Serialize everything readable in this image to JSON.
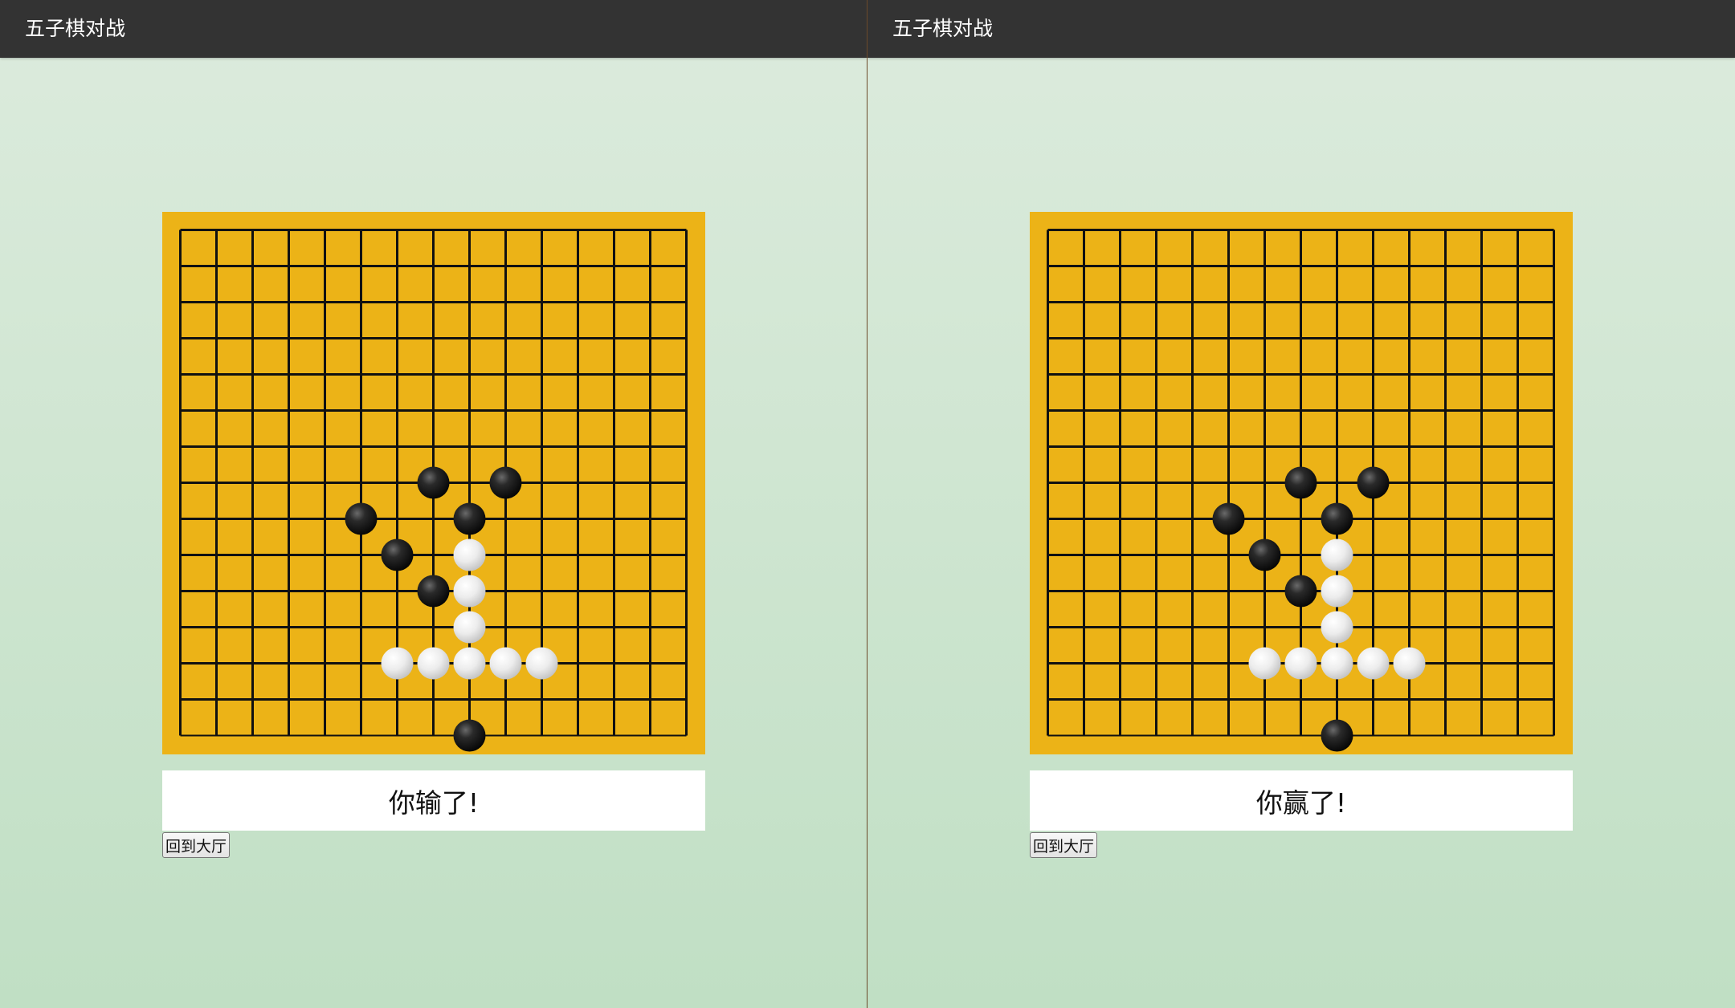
{
  "panes": [
    {
      "nav_title": "五子棋对战",
      "result_text": "你输了!",
      "back_button_label": "回到大厅"
    },
    {
      "nav_title": "五子棋对战",
      "result_text": "你赢了!",
      "back_button_label": "回到大厅"
    }
  ],
  "board": {
    "size": 15,
    "colors": {
      "board": "#ecb317",
      "line": "#111111",
      "black_stone": "#1a1a1a",
      "white_stone": "#e8e8e8"
    },
    "stones": [
      {
        "col": 7,
        "row": 7,
        "color": "black"
      },
      {
        "col": 9,
        "row": 7,
        "color": "black"
      },
      {
        "col": 5,
        "row": 8,
        "color": "black"
      },
      {
        "col": 8,
        "row": 8,
        "color": "black"
      },
      {
        "col": 6,
        "row": 9,
        "color": "black"
      },
      {
        "col": 7,
        "row": 10,
        "color": "black"
      },
      {
        "col": 8,
        "row": 14,
        "color": "black"
      },
      {
        "col": 8,
        "row": 9,
        "color": "white"
      },
      {
        "col": 8,
        "row": 10,
        "color": "white"
      },
      {
        "col": 8,
        "row": 11,
        "color": "white"
      },
      {
        "col": 6,
        "row": 12,
        "color": "white"
      },
      {
        "col": 7,
        "row": 12,
        "color": "white"
      },
      {
        "col": 8,
        "row": 12,
        "color": "white"
      },
      {
        "col": 9,
        "row": 12,
        "color": "white"
      },
      {
        "col": 10,
        "row": 12,
        "color": "white"
      }
    ]
  }
}
